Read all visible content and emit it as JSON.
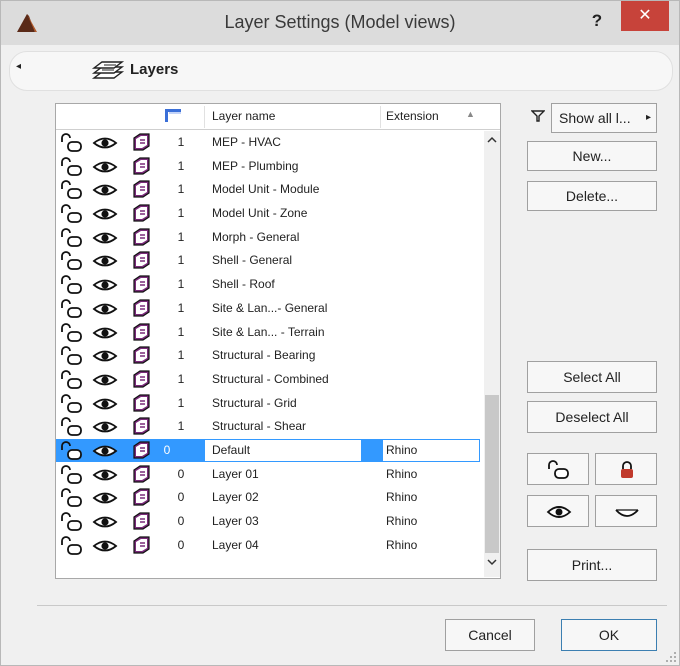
{
  "window": {
    "title": "Layer Settings (Model views)",
    "help_label": "?",
    "close_label": "✕"
  },
  "panel": {
    "title": "Layers",
    "collapse_glyph": "◂"
  },
  "list": {
    "columns": {
      "lock": "lock-icon",
      "visibility": "eye-icon",
      "wireframe": "wireframe-icon",
      "layer_number": "layer-intersection-icon",
      "name": "Layer name",
      "extension": "Extension"
    },
    "sort_indicator": "▲",
    "rows": [
      {
        "num": "1",
        "name": "MEP - HVAC",
        "ext": ""
      },
      {
        "num": "1",
        "name": "MEP - Plumbing",
        "ext": ""
      },
      {
        "num": "1",
        "name": "Model Unit - Module",
        "ext": ""
      },
      {
        "num": "1",
        "name": "Model Unit - Zone",
        "ext": ""
      },
      {
        "num": "1",
        "name": "Morph - General",
        "ext": ""
      },
      {
        "num": "1",
        "name": "Shell - General",
        "ext": ""
      },
      {
        "num": "1",
        "name": "Shell - Roof",
        "ext": ""
      },
      {
        "num": "1",
        "name": "Site & Lan...- General",
        "ext": ""
      },
      {
        "num": "1",
        "name": "Site & Lan... - Terrain",
        "ext": ""
      },
      {
        "num": "1",
        "name": "Structural - Bearing",
        "ext": ""
      },
      {
        "num": "1",
        "name": "Structural - Combined",
        "ext": ""
      },
      {
        "num": "1",
        "name": "Structural - Grid",
        "ext": ""
      },
      {
        "num": "1",
        "name": "Structural - Shear",
        "ext": ""
      },
      {
        "num": "0",
        "name": "Default",
        "ext": "Rhino",
        "selected": true
      },
      {
        "num": "0",
        "name": "Layer 01",
        "ext": "Rhino"
      },
      {
        "num": "0",
        "name": "Layer 02",
        "ext": "Rhino"
      },
      {
        "num": "0",
        "name": "Layer 03",
        "ext": "Rhino"
      },
      {
        "num": "0",
        "name": "Layer 04",
        "ext": "Rhino"
      }
    ],
    "scroll_up": "ˆ",
    "scroll_down": "ˇ"
  },
  "side": {
    "filter_icon": "filter-icon",
    "show_all_label": "Show all l...",
    "show_all_arrow": "▸",
    "new_label": "New...",
    "delete_label": "Delete...",
    "select_all_label": "Select All",
    "deselect_all_label": "Deselect All",
    "print_label": "Print..."
  },
  "footer": {
    "cancel_label": "Cancel",
    "ok_label": "OK"
  },
  "colors": {
    "selection": "#3399ff",
    "close_button": "#c7433a",
    "lock_red": "#c0392b"
  }
}
